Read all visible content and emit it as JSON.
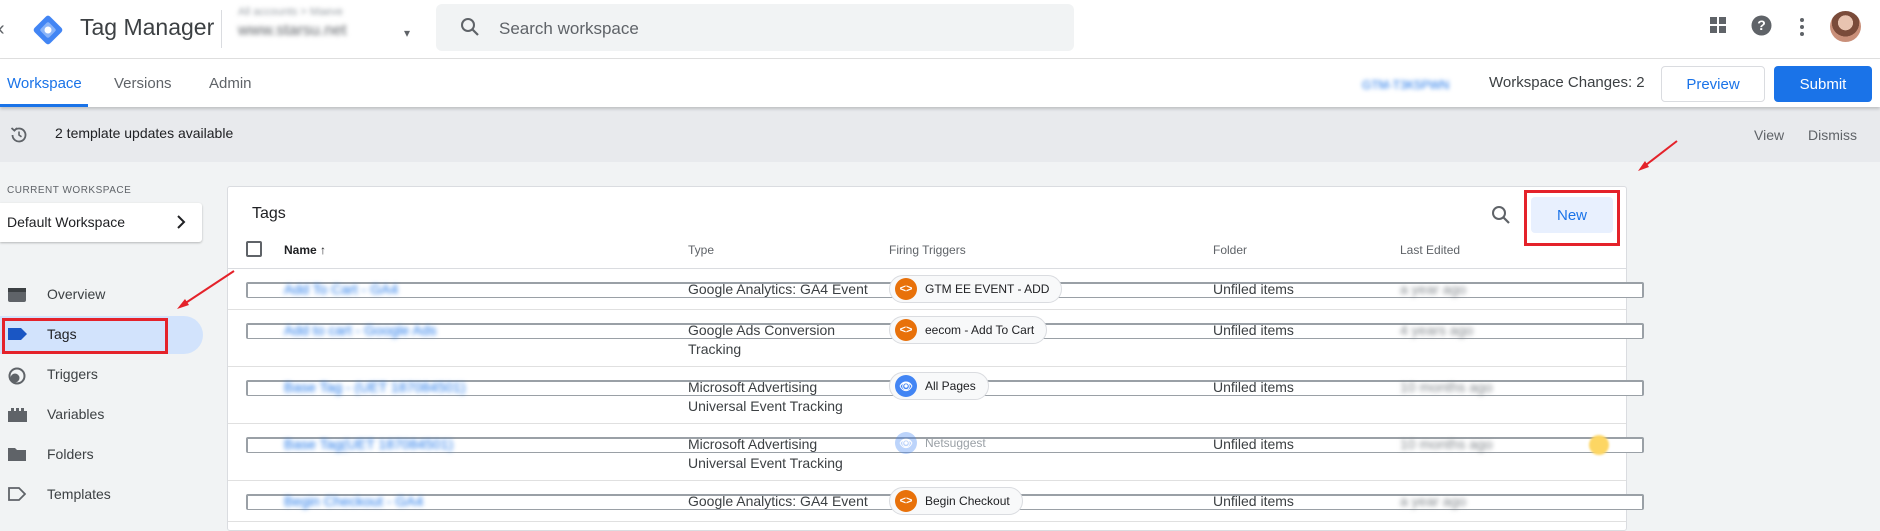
{
  "header": {
    "app_title": "Tag Manager",
    "account_path": "All accounts > Maeve",
    "container_name": "www.starsu.net",
    "search_placeholder": "Search workspace"
  },
  "nav": {
    "tabs": [
      {
        "label": "Workspace",
        "active": true
      },
      {
        "label": "Versions",
        "active": false
      },
      {
        "label": "Admin",
        "active": false
      }
    ],
    "workspace_id": "GTM-T3K5PWN",
    "workspace_changes": "Workspace Changes: 2",
    "preview_label": "Preview",
    "submit_label": "Submit"
  },
  "banner": {
    "text": "2 template updates available",
    "view_label": "View",
    "dismiss_label": "Dismiss"
  },
  "sidebar": {
    "current_workspace_label": "CURRENT WORKSPACE",
    "workspace_name": "Default Workspace",
    "items": [
      {
        "label": "Overview",
        "icon": "overview-icon"
      },
      {
        "label": "Tags",
        "icon": "tag-icon",
        "active": true
      },
      {
        "label": "Triggers",
        "icon": "trigger-icon"
      },
      {
        "label": "Variables",
        "icon": "variables-icon"
      },
      {
        "label": "Folders",
        "icon": "folder-icon"
      },
      {
        "label": "Templates",
        "icon": "template-icon"
      }
    ]
  },
  "tags_panel": {
    "title": "Tags",
    "new_label": "New",
    "columns": {
      "name": "Name",
      "type": "Type",
      "triggers": "Firing Triggers",
      "folder": "Folder",
      "last_edited": "Last Edited"
    },
    "rows": [
      {
        "name": "Add To Cart - GA4",
        "type": "Google Analytics: GA4 Event",
        "trigger": "GTM EE EVENT - ADD",
        "trigger_kind": "custom",
        "folder": "Unfiled items",
        "edited": "a year ago"
      },
      {
        "name": "Add to cart - Google Ads",
        "type": "Google Ads Conversion Tracking",
        "trigger": "eecom - Add To Cart",
        "trigger_kind": "custom",
        "folder": "Unfiled items",
        "edited": "4 years ago"
      },
      {
        "name": "Base Tag - (UET 187084501)",
        "type": "Microsoft Advertising Universal Event Tracking",
        "trigger": "All Pages",
        "trigger_kind": "pageview",
        "folder": "Unfiled items",
        "edited": "10 months ago"
      },
      {
        "name": "Base Tag(UET 187084501)",
        "type": "Microsoft Advertising Universal Event Tracking",
        "trigger": "Netsuggest",
        "trigger_kind": "pageview-faded",
        "folder": "Unfiled items",
        "edited": "10 months ago"
      },
      {
        "name": "Begin Checkout - GA4",
        "type": "Google Analytics: GA4 Event",
        "trigger": "Begin Checkout",
        "trigger_kind": "custom",
        "folder": "Unfiled items",
        "edited": "a year ago"
      }
    ]
  },
  "colors": {
    "accent": "#1a73e8",
    "annotation": "#e4222a",
    "custom_event": "#e8710a",
    "pageview": "#4285f4"
  }
}
